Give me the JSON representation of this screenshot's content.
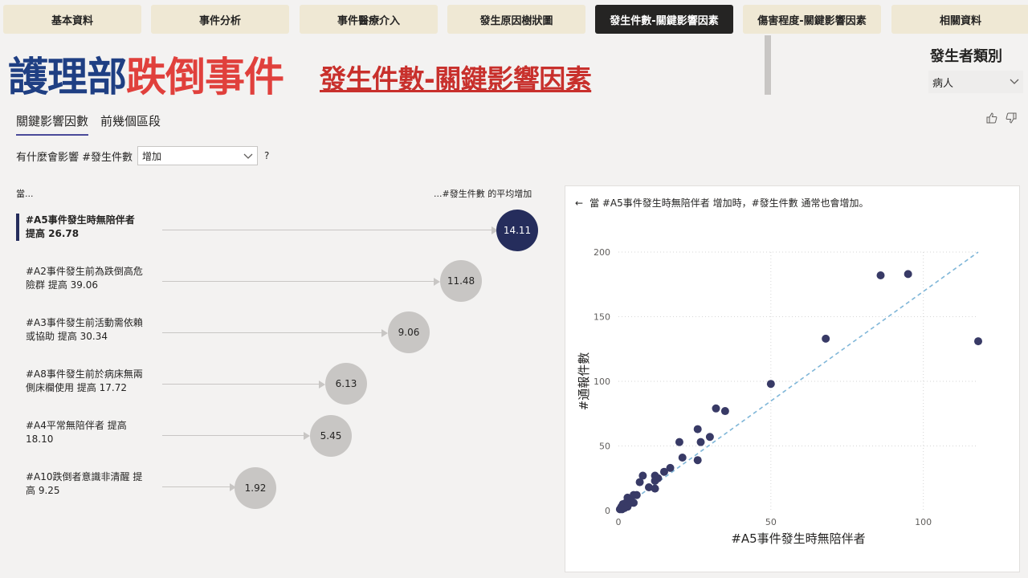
{
  "tabs": [
    {
      "label": "基本資料"
    },
    {
      "label": "事件分析"
    },
    {
      "label": "事件醫療介入"
    },
    {
      "label": "發生原因樹狀圖"
    },
    {
      "label": "發生件數-關鍵影響因素",
      "active": true
    },
    {
      "label": "傷害程度-關鍵影響因素"
    },
    {
      "label": "相關資料"
    }
  ],
  "title": {
    "part1": "護理部",
    "part2": "跌倒事件",
    "subtitle": "發生件數-關鍵影響因素"
  },
  "slicer": {
    "title": "發生者類別",
    "value": "病人"
  },
  "subtabs": [
    "關鍵影響因數",
    "前幾個區段"
  ],
  "question": {
    "label": "有什麼會影響 #發生件數",
    "select": "增加",
    "mark": "?"
  },
  "columns": {
    "left": "當...",
    "right": "...#發生件數 的平均增加"
  },
  "influencers": [
    {
      "label": "#A5事件發生時無陪伴者 提高 26.78",
      "value": "14.11",
      "selected": true
    },
    {
      "label": "#A2事件發生前為跌倒高危險群 提高 39.06",
      "value": "11.48"
    },
    {
      "label": "#A3事件發生前活動需依賴或協助 提高 30.34",
      "value": "9.06"
    },
    {
      "label": "#A8事件發生前於病床無兩側床欄使用 提高 17.72",
      "value": "6.13"
    },
    {
      "label": "#A4平常無陪伴者 提高 18.10",
      "value": "5.45"
    },
    {
      "label": "#A10跌倒者意識非清醒 提高 9.25",
      "value": "1.92"
    }
  ],
  "colors": {
    "accent": "#252d5c",
    "bubble": "#c8c6c4",
    "title_blue": "#1f3f83",
    "title_red": "#e0403c",
    "trend": "#7fb6d8"
  },
  "panel": {
    "header": "當 #A5事件發生時無陪伴者 增加時，#發生件數 通常也會增加。"
  },
  "chart_data": {
    "type": "scatter",
    "xlabel": "#A5事件發生時無陪伴者",
    "ylabel": "#通報件數",
    "xlim": [
      0,
      118
    ],
    "ylim": [
      0,
      200
    ],
    "xticks": [
      0,
      50,
      100
    ],
    "yticks": [
      0,
      50,
      100,
      150,
      200
    ],
    "grid": true,
    "trendline": {
      "x": [
        0,
        118
      ],
      "y": [
        0,
        200
      ]
    },
    "points": [
      {
        "x": 0.5,
        "y": 1
      },
      {
        "x": 0.8,
        "y": 2
      },
      {
        "x": 1,
        "y": 3
      },
      {
        "x": 1.2,
        "y": 1
      },
      {
        "x": 1.5,
        "y": 5
      },
      {
        "x": 2,
        "y": 2
      },
      {
        "x": 2,
        "y": 4
      },
      {
        "x": 2.5,
        "y": 6
      },
      {
        "x": 3,
        "y": 3
      },
      {
        "x": 3,
        "y": 10
      },
      {
        "x": 4,
        "y": 6
      },
      {
        "x": 4,
        "y": 8
      },
      {
        "x": 5,
        "y": 12
      },
      {
        "x": 5,
        "y": 6
      },
      {
        "x": 6,
        "y": 12
      },
      {
        "x": 7,
        "y": 22
      },
      {
        "x": 8,
        "y": 27
      },
      {
        "x": 10,
        "y": 18
      },
      {
        "x": 12,
        "y": 17
      },
      {
        "x": 12,
        "y": 27
      },
      {
        "x": 12,
        "y": 23
      },
      {
        "x": 13,
        "y": 25
      },
      {
        "x": 15,
        "y": 30
      },
      {
        "x": 17,
        "y": 33
      },
      {
        "x": 20,
        "y": 53
      },
      {
        "x": 21,
        "y": 41
      },
      {
        "x": 26,
        "y": 39
      },
      {
        "x": 26,
        "y": 63
      },
      {
        "x": 27,
        "y": 53
      },
      {
        "x": 30,
        "y": 57
      },
      {
        "x": 32,
        "y": 79
      },
      {
        "x": 35,
        "y": 77
      },
      {
        "x": 50,
        "y": 98
      },
      {
        "x": 68,
        "y": 133
      },
      {
        "x": 86,
        "y": 182
      },
      {
        "x": 95,
        "y": 183
      },
      {
        "x": 118,
        "y": 131
      }
    ]
  }
}
